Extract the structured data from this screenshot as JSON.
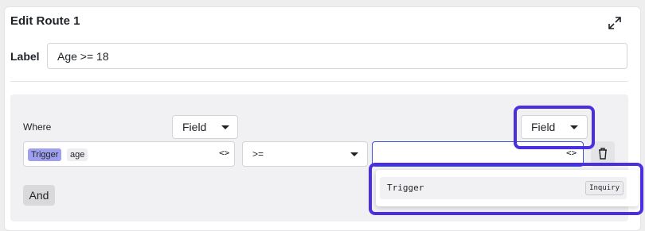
{
  "dialog": {
    "title": "Edit Route 1",
    "expand_icon": "expand-arrows-icon"
  },
  "label_field": {
    "label": "Label",
    "value": "Age >= 18"
  },
  "condition": {
    "where_label": "Where",
    "left_type_button": "Field",
    "right_type_button": "Field",
    "left_operand": {
      "chip_source": "Trigger",
      "chip_field": "age",
      "code_icon": "<>"
    },
    "operator": ">=",
    "right_operand": {
      "value": "",
      "code_icon": "<>"
    },
    "delete_icon": "trash-icon"
  },
  "and_button": "And",
  "dropdown": {
    "items": [
      {
        "label": "Trigger",
        "badge": "Inquiry"
      }
    ]
  },
  "colors": {
    "highlight": "#4a2fe0",
    "focus_border": "#3b54d6",
    "chip_trigger": "#9f9ff0"
  }
}
